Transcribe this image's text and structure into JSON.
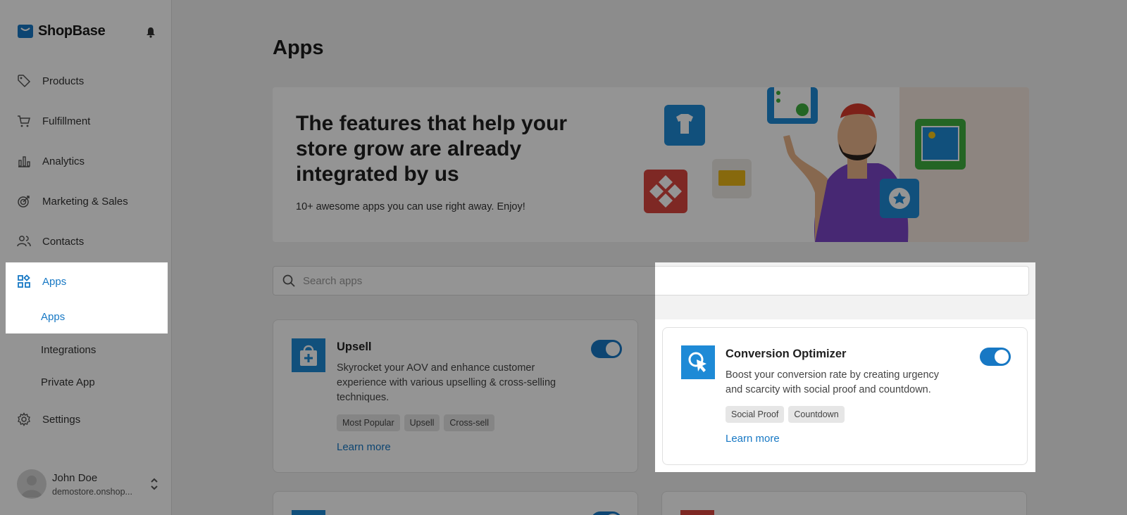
{
  "brand": {
    "name": "ShopBase"
  },
  "sidebar": {
    "items": [
      {
        "label": "Products",
        "icon": "tag-icon"
      },
      {
        "label": "Fulfillment",
        "icon": "cart-icon"
      },
      {
        "label": "Analytics",
        "icon": "bar-chart-icon"
      },
      {
        "label": "Marketing & Sales",
        "icon": "target-icon"
      },
      {
        "label": "Contacts",
        "icon": "users-icon"
      },
      {
        "label": "Apps",
        "icon": "apps-grid-icon",
        "active": true
      },
      {
        "label": "Settings",
        "icon": "gear-icon"
      }
    ],
    "sub_items": [
      {
        "label": "Apps",
        "active": true
      },
      {
        "label": "Integrations"
      },
      {
        "label": "Private App"
      }
    ],
    "user": {
      "name": "John Doe",
      "store": "demostore.onshop..."
    }
  },
  "main": {
    "title": "Apps",
    "banner": {
      "heading": "The features that help your store grow are already integrated by us",
      "subtext": "10+ awesome apps you can use right away. Enjoy!"
    },
    "search": {
      "placeholder": "Search apps"
    },
    "apps": [
      {
        "title": "Upsell",
        "description": "Skyrocket your AOV and enhance customer experience with various upselling & cross-selling techniques.",
        "tags": [
          "Most Popular",
          "Upsell",
          "Cross-sell"
        ],
        "learn_more": "Learn more",
        "enabled": true
      },
      {
        "title": "Conversion Optimizer",
        "description": "Boost your conversion rate by creating urgency and scarcity with social proof and countdown.",
        "tags": [
          "Social Proof",
          "Countdown"
        ],
        "learn_more": "Learn more",
        "enabled": true
      }
    ]
  },
  "colors": {
    "accent": "#1778c4",
    "overlay": "rgba(0,0,0,0.42)"
  }
}
